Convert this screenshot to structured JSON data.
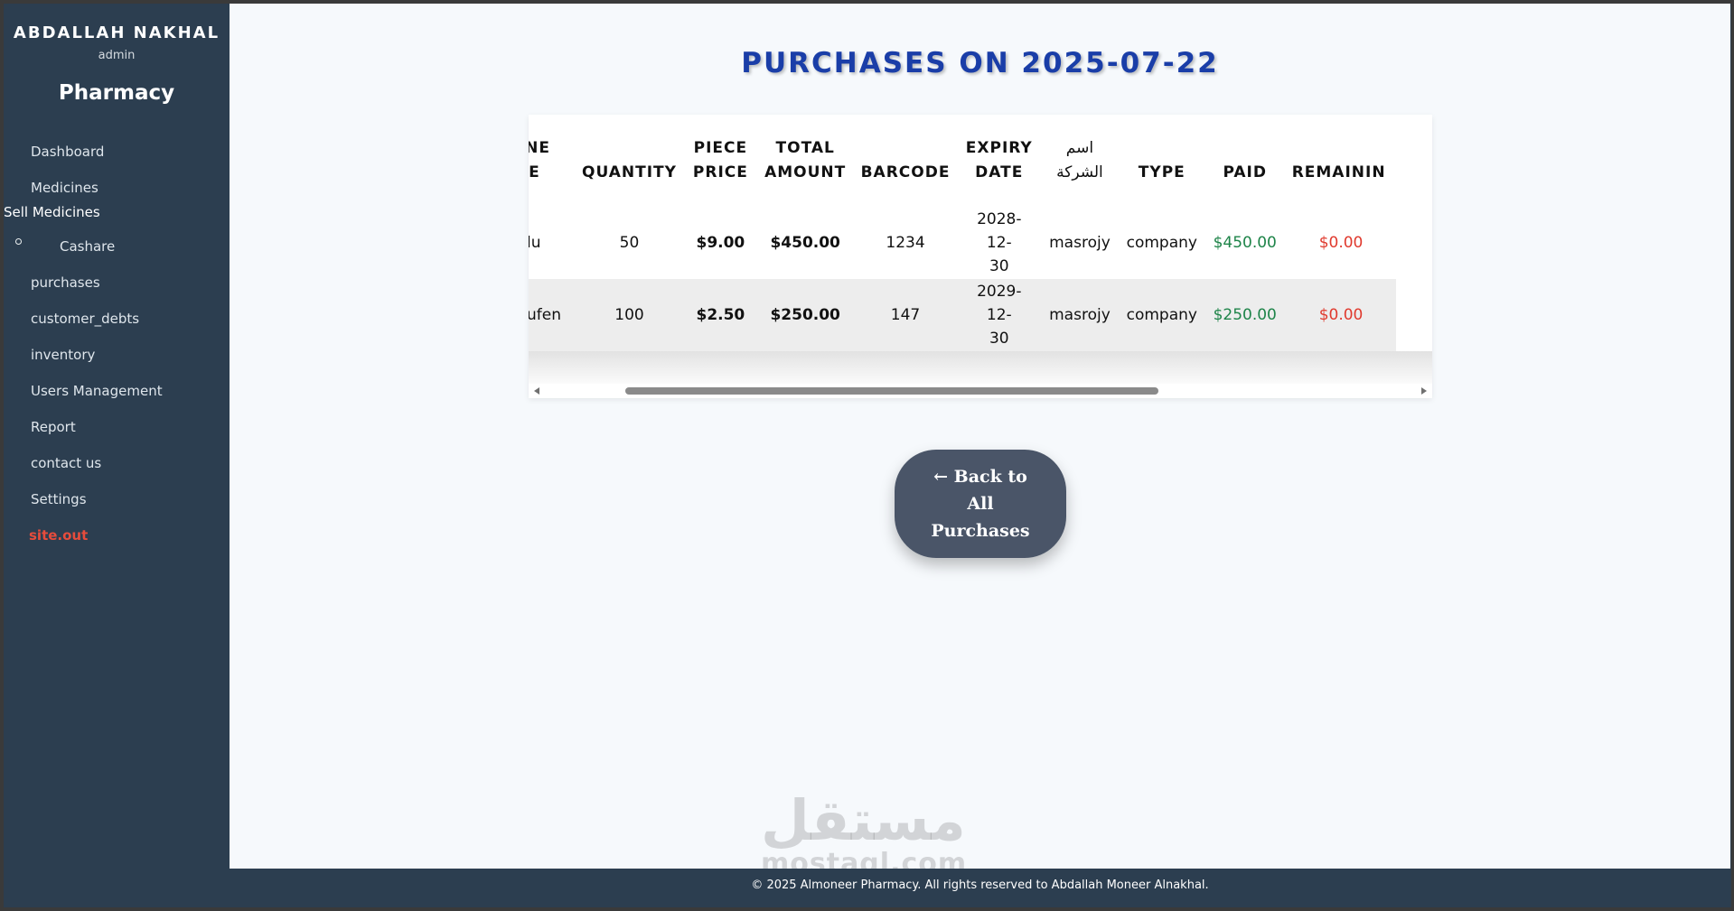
{
  "sidebar": {
    "user_name": "ABDALLAH NAKHAL",
    "user_role": "admin",
    "brand": "Pharmacy",
    "items": [
      {
        "label": "Dashboard"
      },
      {
        "label": "Medicines"
      },
      {
        "label": "Sell Medicines"
      },
      {
        "label": "Cashare"
      },
      {
        "label": "purchases"
      },
      {
        "label": "customer_debts"
      },
      {
        "label": "inventory"
      },
      {
        "label": "Users Management"
      },
      {
        "label": "Report"
      },
      {
        "label": "contact us"
      },
      {
        "label": "Settings"
      },
      {
        "label": "site.out"
      }
    ]
  },
  "main": {
    "title": "PURCHASES ON 2025-07-22",
    "table": {
      "headers": [
        "ICINE AME",
        "QUANTITY",
        "PIECE PRICE",
        "TOTAL AMOUNT",
        "BARCODE",
        "EXPIRY DATE",
        "اسم الشركة",
        "TYPE",
        "PAID",
        "REMAININ"
      ],
      "header_lines": [
        [
          "ICINE",
          "AME"
        ],
        [
          "QUANTITY"
        ],
        [
          "PIECE",
          "PRICE"
        ],
        [
          "TOTAL",
          "AMOUNT"
        ],
        [
          "BARCODE"
        ],
        [
          "EXPIRY",
          "DATE"
        ],
        [
          "اسم",
          "الشركة"
        ],
        [
          "TYPE"
        ],
        [
          "PAID"
        ],
        [
          "REMAININ"
        ]
      ],
      "rows": [
        {
          "name": "lu",
          "quantity": "50",
          "piece_price": "$9.00",
          "total_amount": "$450.00",
          "barcode": "1234",
          "expiry_1": "2028-12-",
          "expiry_2": "30",
          "company": "masrojy",
          "type": "company",
          "paid": "$450.00",
          "remaining": "$0.00"
        },
        {
          "name": "ufen",
          "quantity": "100",
          "piece_price": "$2.50",
          "total_amount": "$250.00",
          "barcode": "147",
          "expiry_1": "2029-12-",
          "expiry_2": "30",
          "company": "masrojy",
          "type": "company",
          "paid": "$250.00",
          "remaining": "$0.00"
        }
      ]
    },
    "back_button": {
      "line1": "← Back to",
      "line2": "All",
      "line3": "Purchases"
    },
    "watermark": {
      "arabic": "مستقل",
      "latin": "mostaql.com"
    }
  },
  "footer": {
    "text": "© 2025 Almoneer Pharmacy. All rights reserved to Abdallah Moneer Alnakhal."
  },
  "colors": {
    "sidebar_bg": "#2c3e50",
    "title_blue": "#1a3ea8",
    "paid_green": "#1e8449",
    "remaining_red": "#e03a2e",
    "logout_red": "#e74c3c",
    "button_bg": "#4a5568"
  }
}
